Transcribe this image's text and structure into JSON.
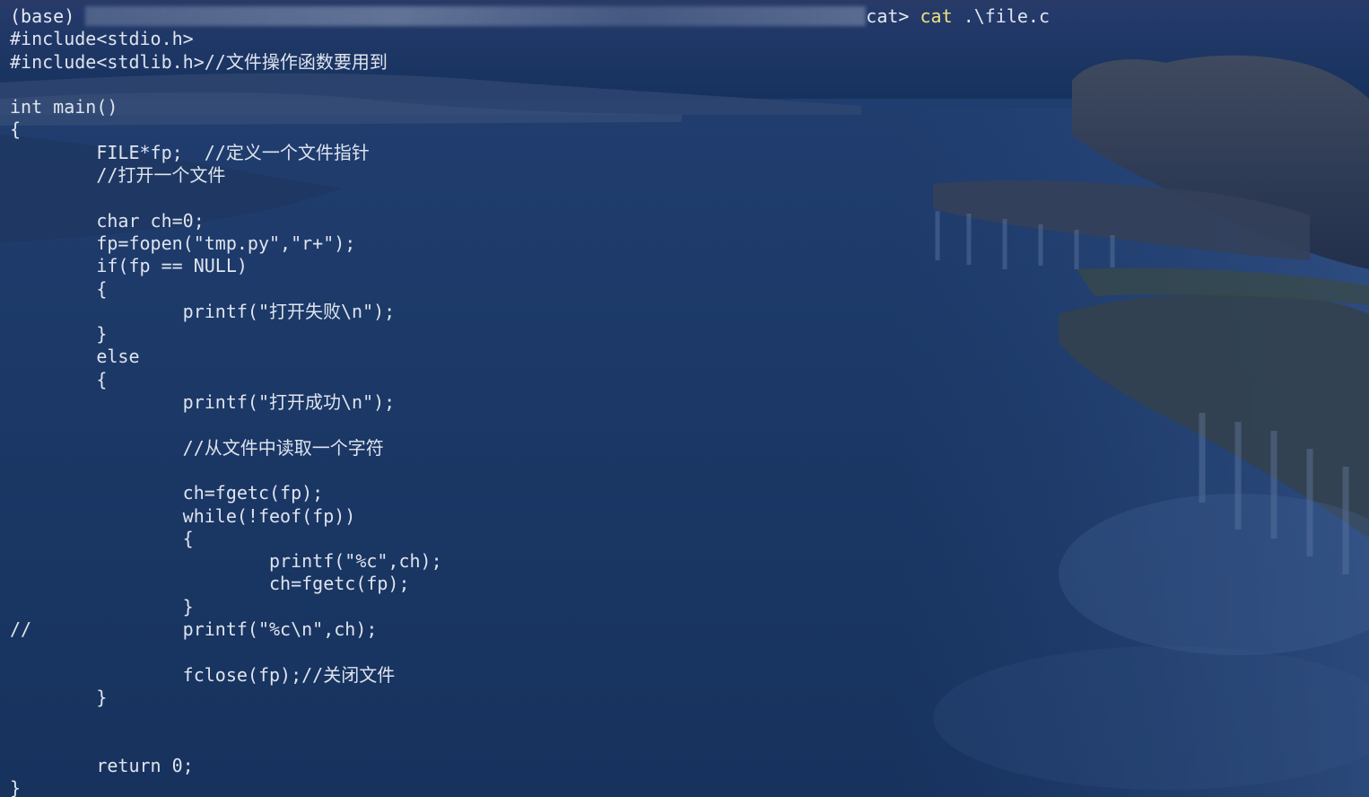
{
  "prompt": {
    "prefix": "(base) ",
    "redacted_path_suffix": "cat>",
    "command": "cat",
    "argument": ".\\file.c"
  },
  "code_lines": [
    "#include<stdio.h>",
    "#include<stdlib.h>//文件操作函数要用到",
    "",
    "int main()",
    "{",
    "        FILE*fp;  //定义一个文件指针",
    "        //打开一个文件",
    "",
    "        char ch=0;",
    "        fp=fopen(\"tmp.py\",\"r+\");",
    "        if(fp == NULL)",
    "        {",
    "                printf(\"打开失败\\n\");",
    "        }",
    "        else",
    "        {",
    "                printf(\"打开成功\\n\");",
    "",
    "                //从文件中读取一个字符",
    "",
    "                ch=fgetc(fp);",
    "                while(!feof(fp))",
    "                {",
    "                        printf(\"%c\",ch);",
    "                        ch=fgetc(fp);",
    "                }",
    "//              printf(\"%c\\n\",ch);",
    "",
    "                fclose(fp);//关闭文件",
    "        }",
    "",
    "",
    "        return 0;",
    "}"
  ],
  "colors": {
    "background": "#1b3562",
    "text": "#dfe4ee",
    "command_highlight": "#f1e07a"
  }
}
